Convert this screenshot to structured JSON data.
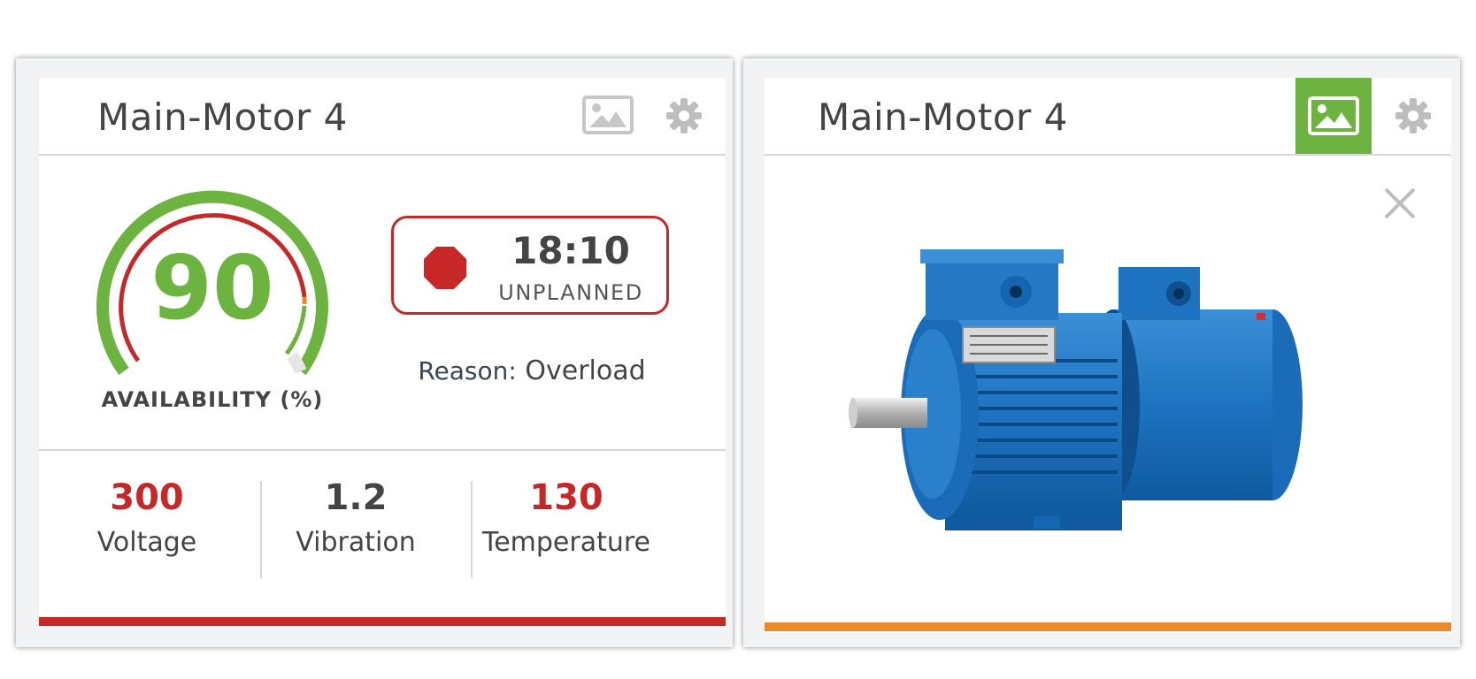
{
  "cards": [
    {
      "title": "Main-Motor 4",
      "availability": {
        "value": "90",
        "label": "AVAILABILITY (%)",
        "percent": 90
      },
      "status": {
        "time": "18:10",
        "kind": "UNPLANNED",
        "reason_key": "Reason:",
        "reason_value": "Overload"
      },
      "metrics": [
        {
          "value": "300",
          "label": "Voltage",
          "color": "#c62828"
        },
        {
          "value": "1.2",
          "label": "Vibration",
          "color": "#444444"
        },
        {
          "value": "130",
          "label": "Temperature",
          "color": "#c62828"
        }
      ],
      "status_bar_color": "#c62828",
      "icons": [
        "image-icon",
        "gear-icon",
        "stop-icon"
      ]
    },
    {
      "title": "Main-Motor 4",
      "image": "electric-motor-image",
      "status_bar_color": "#e98b2a",
      "active_tab": "image",
      "icons": [
        "image-icon",
        "gear-icon",
        "close-icon"
      ]
    }
  ],
  "colors": {
    "good": "#6db33f",
    "alarm": "#c62828",
    "warning": "#e98b2a"
  }
}
